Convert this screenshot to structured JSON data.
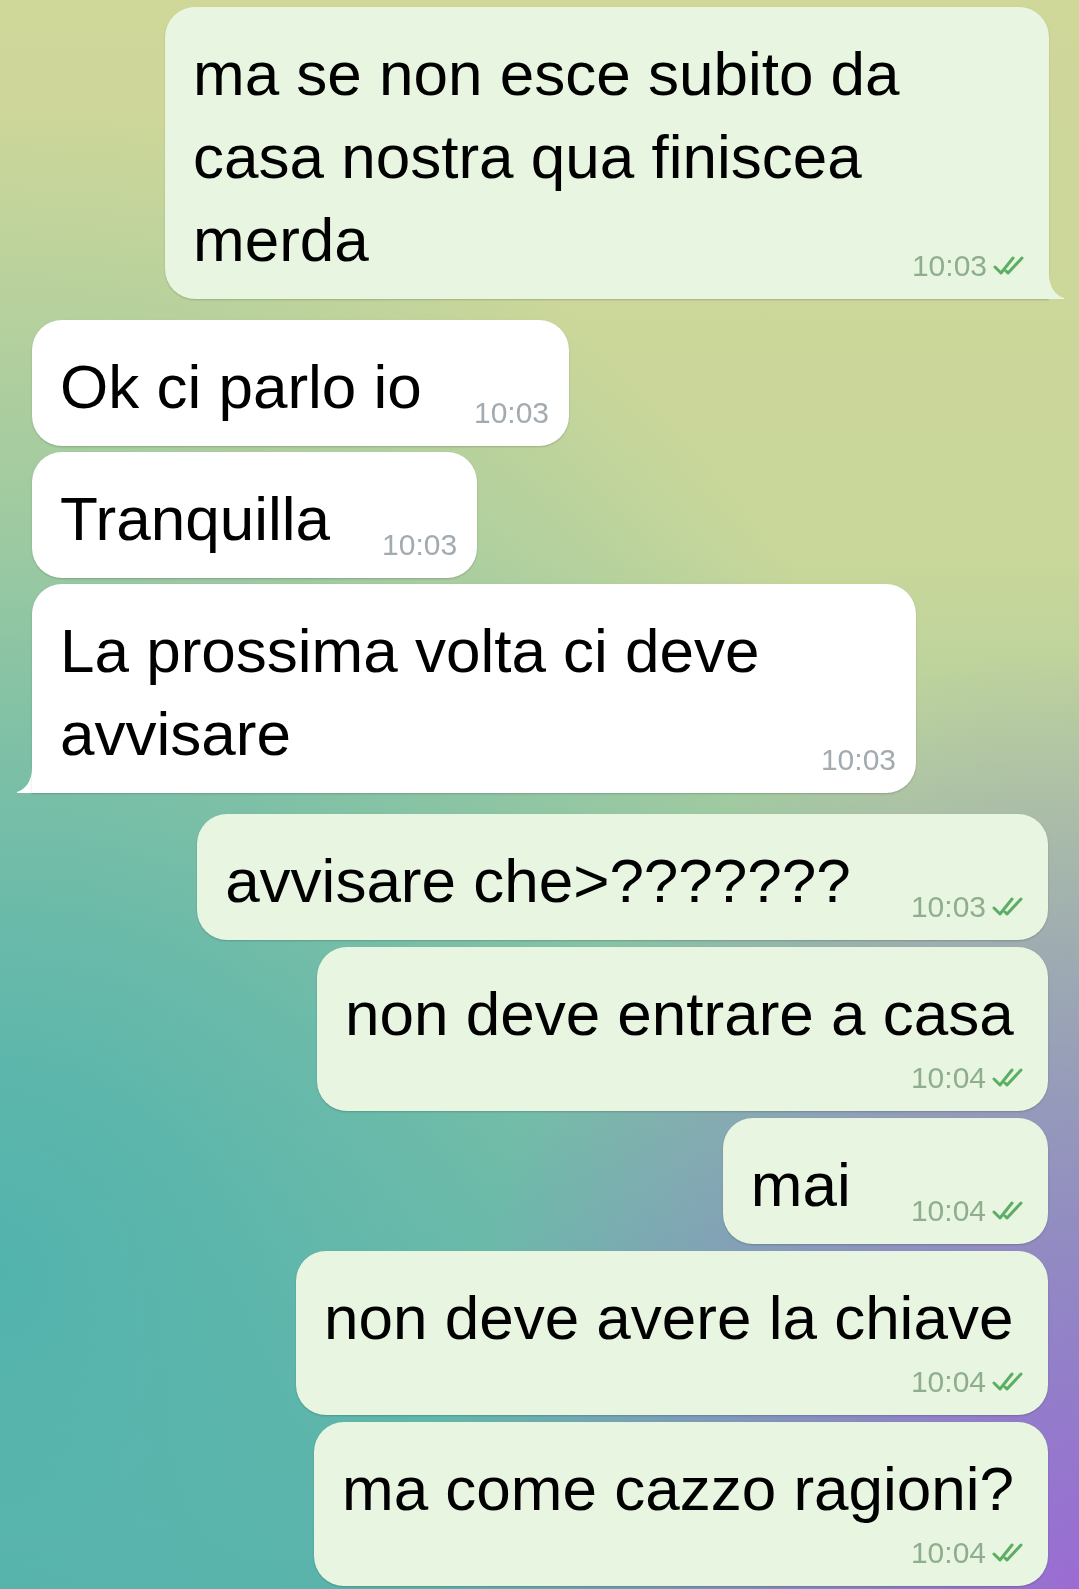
{
  "messages": [
    {
      "kind": "outgoing",
      "text": "ma se non esce subito da casa nostra qua finiscea merda",
      "time": "10:03",
      "read": true,
      "tail": true
    },
    {
      "kind": "incoming",
      "text": "Ok ci parlo io",
      "time": "10:03",
      "tail": false
    },
    {
      "kind": "incoming",
      "text": "Tranquilla",
      "time": "10:03",
      "tail": false
    },
    {
      "kind": "incoming",
      "text": "La prossima volta ci deve avvisare",
      "time": "10:03",
      "tail": true
    },
    {
      "kind": "outgoing",
      "text": "avvisare che>???????",
      "time": "10:03",
      "read": true,
      "tail": false
    },
    {
      "kind": "outgoing",
      "text": "non deve entrare a casa",
      "time": "10:04",
      "read": true,
      "tail": false
    },
    {
      "kind": "outgoing",
      "text": "mai",
      "time": "10:04",
      "read": true,
      "tail": false
    },
    {
      "kind": "outgoing",
      "text": "non deve avere la chiave",
      "time": "10:04",
      "read": true,
      "tail": false
    },
    {
      "kind": "outgoing",
      "text": "ma come cazzo ragioni?",
      "time": "10:04",
      "read": true,
      "tail": false
    }
  ]
}
